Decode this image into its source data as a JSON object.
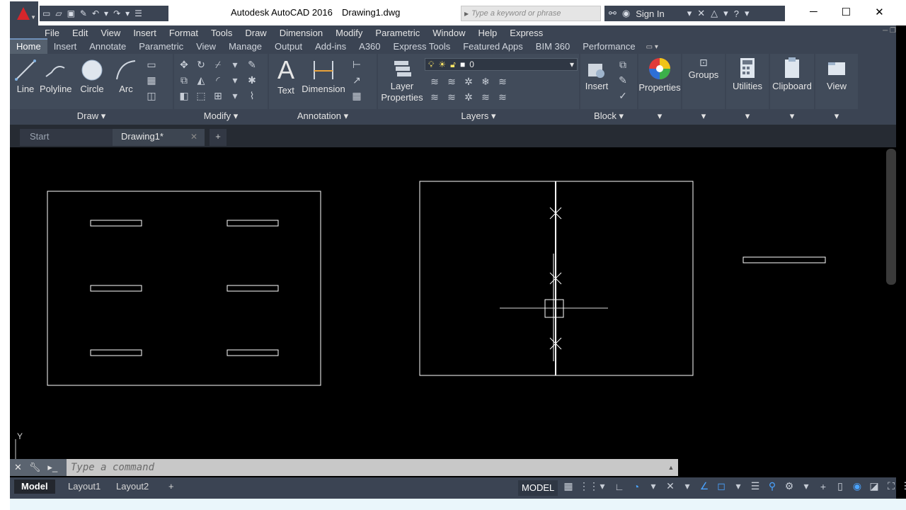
{
  "titlebar": {
    "app_title": "Autodesk AutoCAD 2016",
    "file_name": "Drawing1.dwg",
    "search_placeholder": "Type a keyword or phrase",
    "sign_in": "Sign In"
  },
  "menubar": [
    "File",
    "Edit",
    "View",
    "Insert",
    "Format",
    "Tools",
    "Draw",
    "Dimension",
    "Modify",
    "Parametric",
    "Window",
    "Help",
    "Express"
  ],
  "ribbon_tabs": [
    "Home",
    "Insert",
    "Annotate",
    "Parametric",
    "View",
    "Manage",
    "Output",
    "Add-ins",
    "A360",
    "Express Tools",
    "Featured Apps",
    "BIM 360",
    "Performance"
  ],
  "ribbon": {
    "draw": {
      "title": "Draw",
      "line": "Line",
      "polyline": "Polyline",
      "circle": "Circle",
      "arc": "Arc"
    },
    "modify": {
      "title": "Modify"
    },
    "annotation": {
      "title": "Annotation",
      "text": "Text",
      "dimension": "Dimension"
    },
    "layers": {
      "title": "Layers",
      "layer_properties_1": "Layer",
      "layer_properties_2": "Properties",
      "current_layer": "0"
    },
    "block": {
      "title": "Block",
      "insert": "Insert"
    },
    "properties": "Properties",
    "groups": "Groups",
    "utilities": "Utilities",
    "clipboard": "Clipboard",
    "view": "View"
  },
  "doc_tabs": {
    "start": "Start",
    "current": "Drawing1*"
  },
  "ucs": {
    "y_label": "Y"
  },
  "command": {
    "placeholder": "Type a command"
  },
  "layout_tabs": [
    "Model",
    "Layout1",
    "Layout2"
  ],
  "status": {
    "model": "MODEL"
  }
}
